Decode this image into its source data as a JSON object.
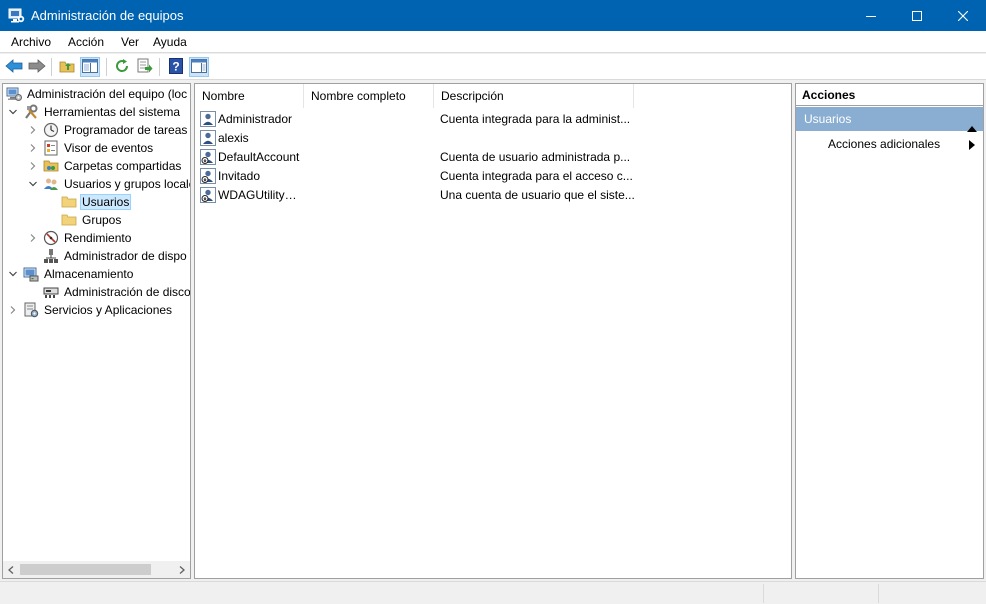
{
  "window": {
    "title": "Administración de equipos",
    "icon": "computer-management-icon",
    "accent": "#0063b1"
  },
  "menu": [
    "Archivo",
    "Acción",
    "Ver",
    "Ayuda"
  ],
  "toolbar": [
    "back-arrow-icon",
    "forward-arrow-icon",
    "up-folder-icon",
    "show-tree-icon",
    "refresh-icon",
    "export-list-icon",
    "help-icon",
    "show-action-pane-icon"
  ],
  "tree": {
    "root": "Administración del equipo (loc",
    "system_tools": "Herramientas del sistema",
    "task_scheduler": "Programador de tareas",
    "event_viewer": "Visor de eventos",
    "shared_folders": "Carpetas compartidas",
    "local_users": "Usuarios y grupos locale",
    "users": "Usuarios",
    "groups": "Grupos",
    "performance": "Rendimiento",
    "device_manager": "Administrador de dispo",
    "storage": "Almacenamiento",
    "disk_management": "Administración de disco",
    "services": "Servicios y Aplicaciones"
  },
  "list": {
    "columns": [
      "Nombre",
      "Nombre completo",
      "Descripción"
    ],
    "rows": [
      {
        "name": "Administrador",
        "full_name": "",
        "description": "Cuenta integrada para la administ..."
      },
      {
        "name": "alexis",
        "full_name": "",
        "description": ""
      },
      {
        "name": "DefaultAccount",
        "full_name": "",
        "description": "Cuenta de usuario administrada p..."
      },
      {
        "name": "Invitado",
        "full_name": "",
        "description": "Cuenta integrada para el acceso c..."
      },
      {
        "name": "WDAGUtilityA...",
        "full_name": "",
        "description": "Una cuenta de usuario que el siste..."
      }
    ]
  },
  "actions": {
    "header": "Acciones",
    "section": "Usuarios",
    "item": "Acciones adicionales",
    "section_color": "#8aaed2"
  }
}
